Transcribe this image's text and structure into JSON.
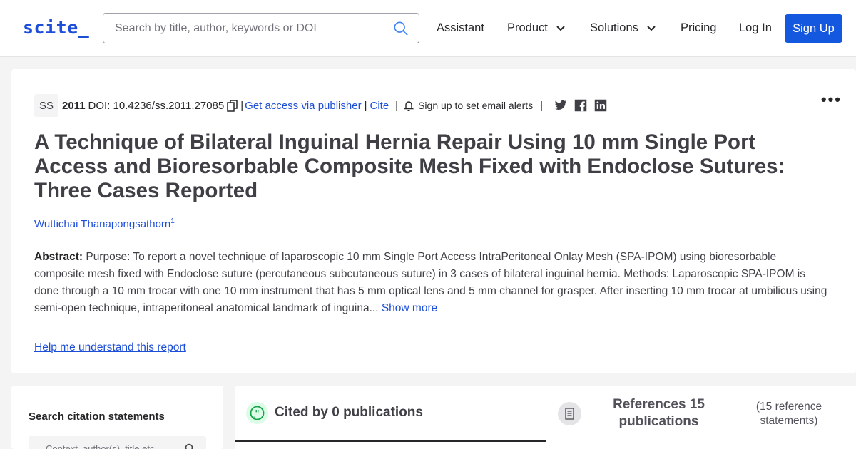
{
  "header": {
    "logo": "scite_",
    "search_placeholder": "Search by title, author, keywords or DOI",
    "nav": {
      "assistant": "Assistant",
      "product": "Product",
      "solutions": "Solutions",
      "pricing": "Pricing",
      "login": "Log In",
      "signup": "Sign Up"
    }
  },
  "article": {
    "journal_abbr": "SS",
    "year": "2011",
    "doi": "DOI: 10.4236/ss.2011.27085",
    "publisher_link": "Get access via publisher",
    "cite_link": "Cite",
    "alert_text": "Sign up to set email alerts",
    "title": "A Technique of Bilateral Inguinal Hernia Repair Using 10 mm Single Port Access and Bioresorbable Composite Mesh Fixed with Endoclose Sutures: Three Cases Reported",
    "author": "Wuttichai Thanapongsathorn",
    "author_affil": "1",
    "abstract_label": "Abstract:",
    "abstract_text": " Purpose: To report a novel technique of laparoscopic 10 mm Single Port Access IntraPeritoneal Onlay Mesh (SPA-IPOM) using bioresorbable composite mesh fixed with Endoclose suture (percutaneous subcutaneous suture) in 3 cases of bilateral inguinal hernia. Methods: Laparoscopic SPA-IPOM is done through a 10 mm trocar with one 10 mm instrument that has 5 mm optical lens and 5 mm channel for grasper. After inserting 10 mm trocar at umbilicus using semi-open technique, intraperitoneal anatomical landmark of inguina...",
    "show_more": "Show more",
    "help_link": "Help me understand this report"
  },
  "sidebar": {
    "heading": "Search citation statements",
    "search_placeholder": "Context, author(s), title etc"
  },
  "tabs": {
    "cited_by": "Cited by 0 publications",
    "references": "References 15 publications",
    "reference_statements": "(15 reference statements)"
  },
  "colors": {
    "accent": "#1558e0",
    "link": "#1d4ed8"
  },
  "icons": {
    "search": "search-icon",
    "copy": "copy-icon",
    "bell": "bell-icon",
    "twitter": "twitter-icon",
    "facebook": "facebook-icon",
    "linkedin": "linkedin-icon",
    "more": "more-dots-icon",
    "cited": "quote-icon",
    "references": "document-icon"
  }
}
